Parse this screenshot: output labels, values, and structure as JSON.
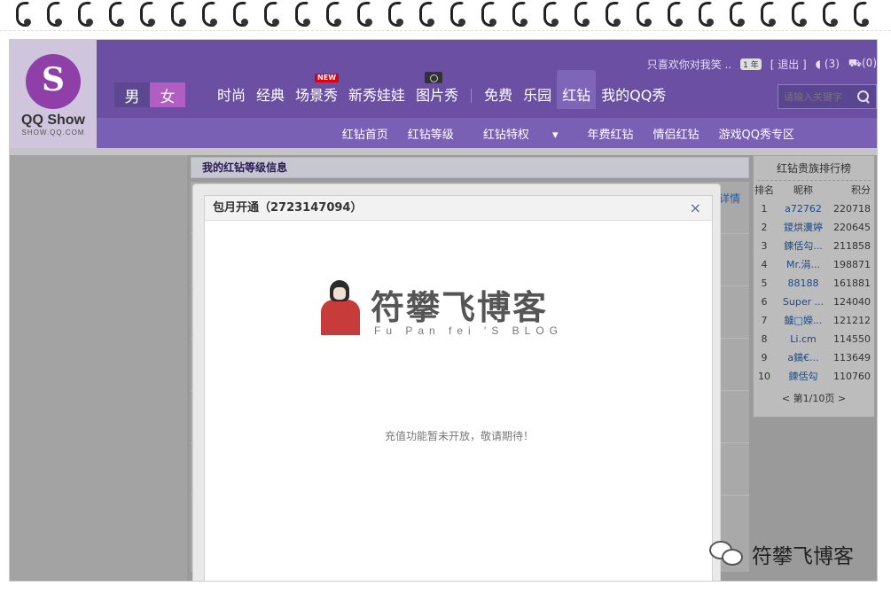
{
  "logo": {
    "brand": "QQ Show",
    "domain": "SHOW.QQ.COM"
  },
  "topbar": {
    "user": "只喜欢你对我笑 ..",
    "badge": "1 年",
    "logout": "[ 退出 ]",
    "messages": "(3)",
    "cart": "(0)"
  },
  "gender": {
    "male": "男",
    "female": "女"
  },
  "mainnav": {
    "items": [
      "时尚",
      "经典",
      "场景秀",
      "新秀娃娃",
      "图片秀",
      "免费",
      "乐园",
      "红钻",
      "我的QQ秀"
    ],
    "new_tag": "NEW"
  },
  "search": {
    "placeholder": "请输入关键字"
  },
  "subnav": {
    "items": [
      "红钻首页",
      "红钻等级",
      "红钻特权",
      "年费红钻",
      "情侣红钻",
      "游戏QQ秀专区"
    ],
    "dropdown_mark": "▾"
  },
  "section": {
    "title": "我的红钻等级信息",
    "detail": "详情"
  },
  "ranking": {
    "title": "红钻贵族排行榜",
    "headers": [
      "排名",
      "昵称",
      "积分"
    ],
    "rows": [
      [
        "1",
        "a72762",
        "220718"
      ],
      [
        "2",
        "鑁烘瀵婷",
        "220645"
      ],
      [
        "3",
        "鍊佸勾...",
        "211858"
      ],
      [
        "4",
        "Mr.涓...",
        "198871"
      ],
      [
        "5",
        "88188",
        "161881"
      ],
      [
        "6",
        "Super ...",
        "124040"
      ],
      [
        "7",
        "鐪□嬫...",
        "121212"
      ],
      [
        "8",
        "Li.cm",
        "114550"
      ],
      [
        "9",
        "a鎬€...",
        "113649"
      ],
      [
        "10",
        "鍊佸勾",
        "110760"
      ]
    ],
    "pager": "<  第1/10页  >"
  },
  "modal": {
    "title": "包月开通（2723147094）",
    "close": "×",
    "notice": "充值功能暂未开放，敬请期待！"
  },
  "watermark": {
    "title": "符攀飞博客",
    "subtitle": "Fu Pan fei 'S BLOG"
  },
  "wechat_label": "符攀飞博客"
}
